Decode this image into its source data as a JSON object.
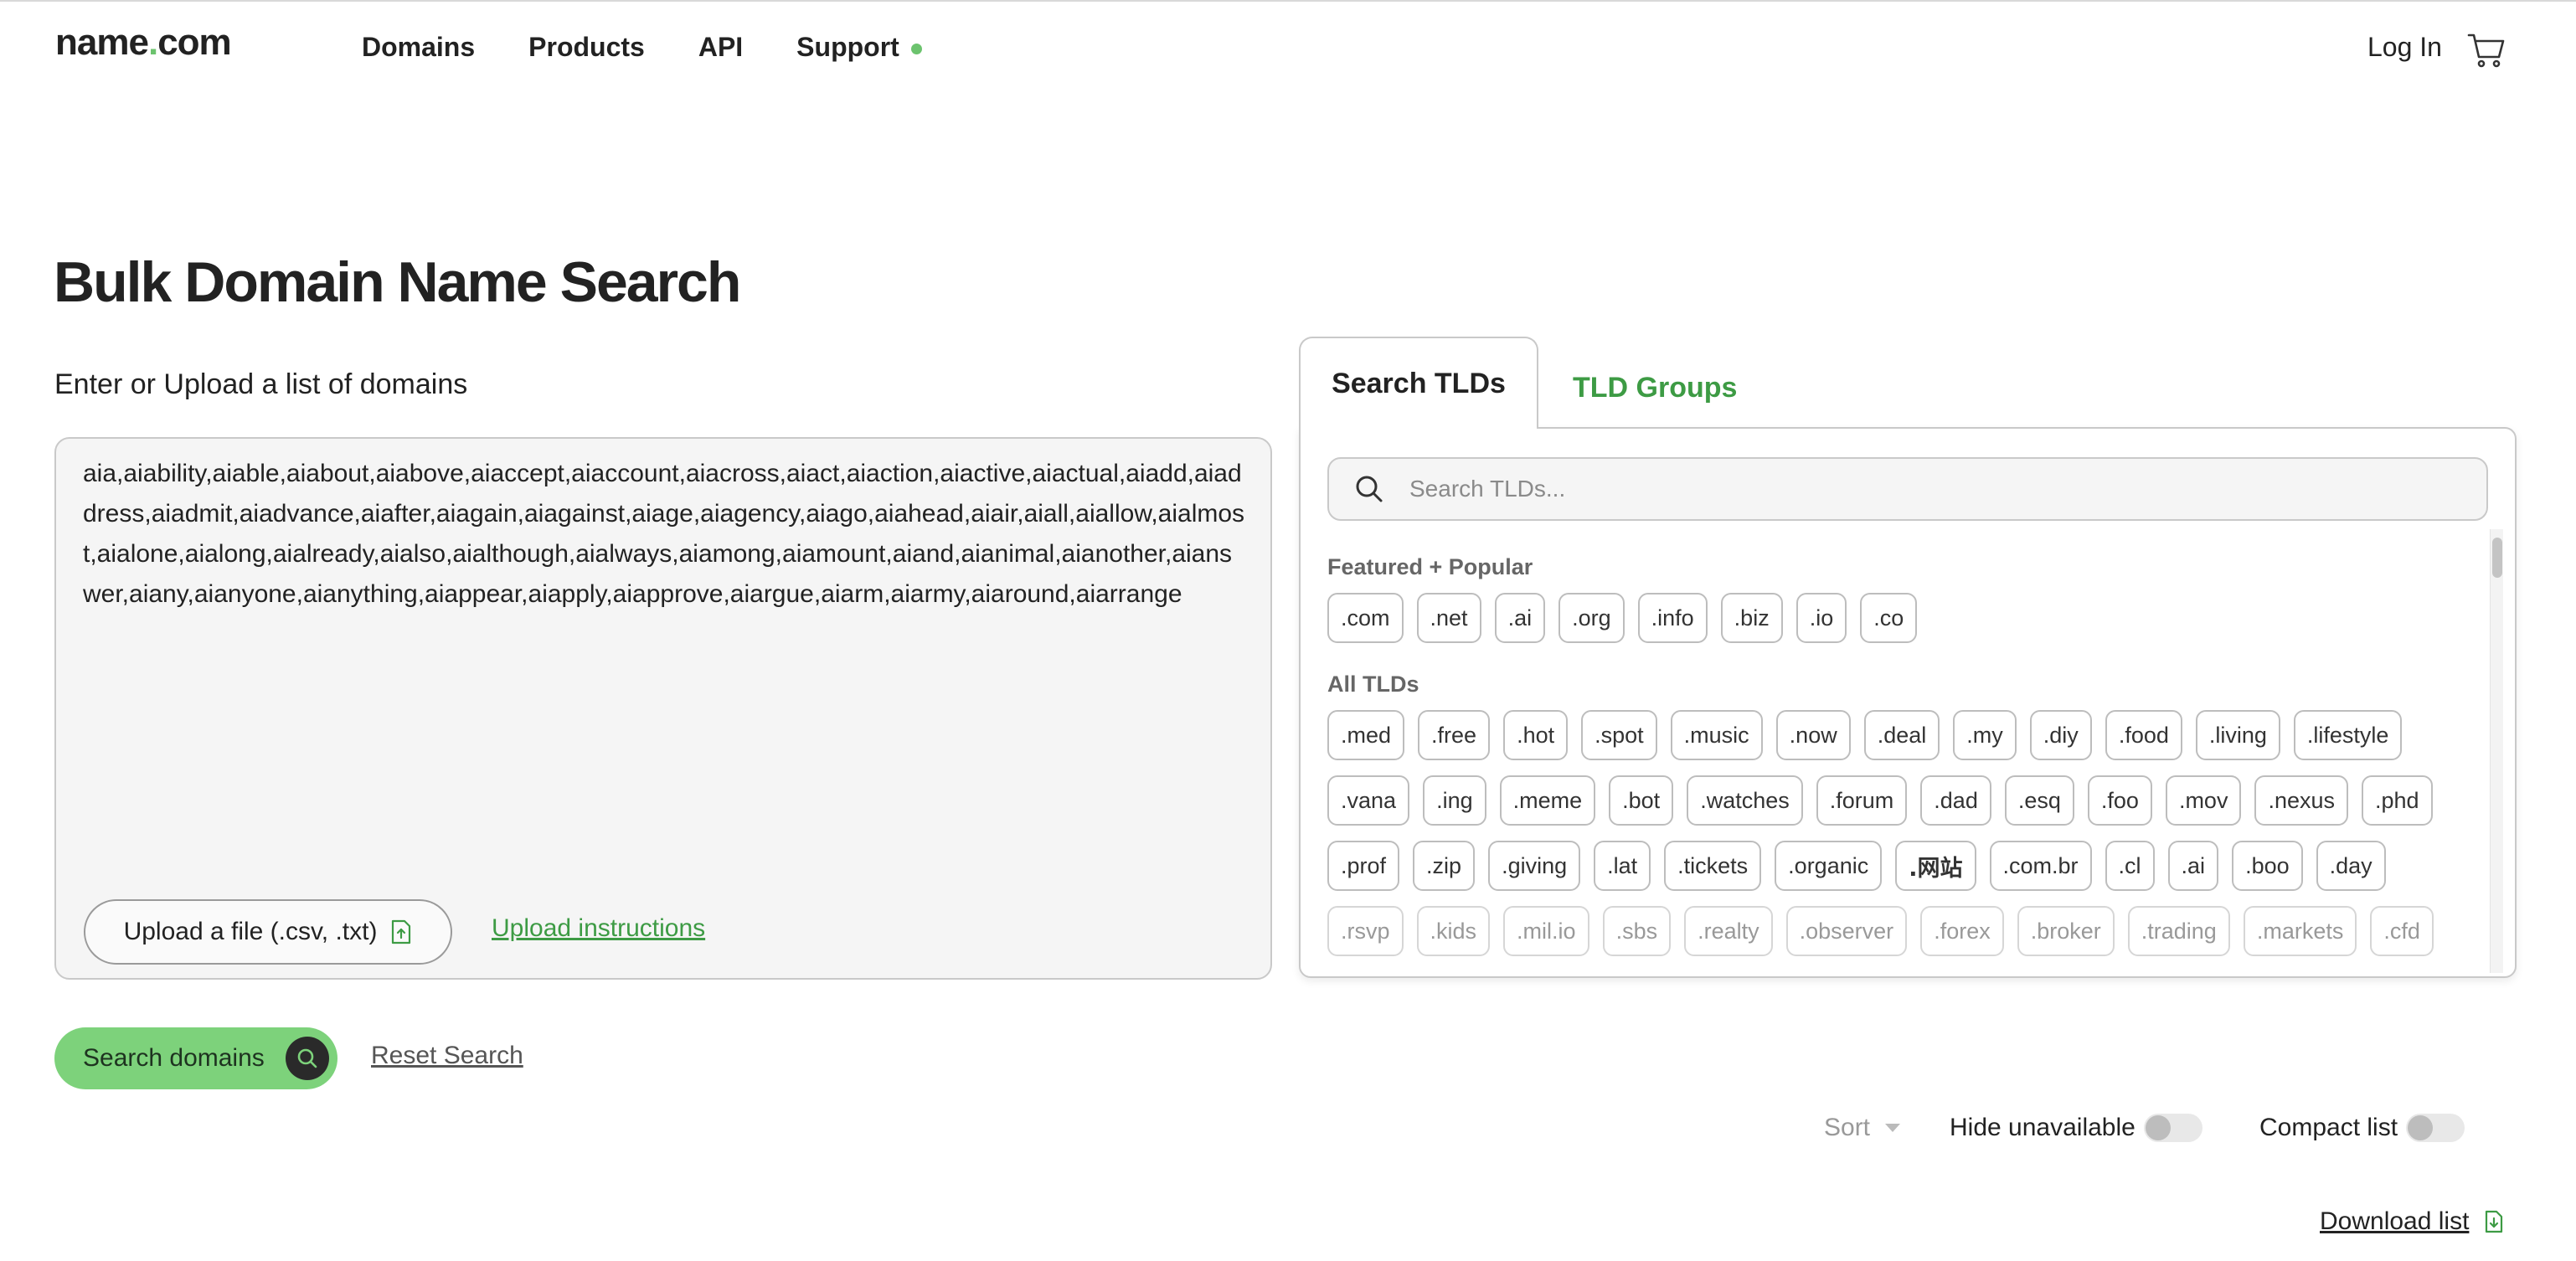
{
  "header": {
    "logo_name": "name",
    "logo_dot": ".",
    "logo_tld": "com",
    "nav": [
      {
        "label": "Domains"
      },
      {
        "label": "Products"
      },
      {
        "label": "API"
      },
      {
        "label": "Support"
      }
    ],
    "login_label": "Log In",
    "cart_icon": "cart-icon"
  },
  "page": {
    "title": "Bulk Domain Name Search",
    "input_label": "Enter or Upload a list of domains",
    "domain_list": "aia,aiability,aiable,aiabout,aiabove,aiaccept,aiaccount,aiacross,aiact,aiaction,aiactive,aiactual,aiadd,aiaddress,aiadmit,aiadvance,aiafter,aiagain,aiagainst,aiage,aiagency,aiago,aiahead,aiair,aiall,aiallow,aialmost,aialone,aialong,aialready,aialso,aialthough,aialways,aiamong,aiamount,aiand,aianimal,aianother,aianswer,aiany,aianyone,aianything,aiappear,aiapply,aiapprove,aiargue,aiarm,aiarmy,aiaround,aiarrange",
    "upload_button": "Upload a file (.csv, .txt)",
    "upload_instructions": "Upload instructions",
    "search_button": "Search domains",
    "reset_link": "Reset Search"
  },
  "tld_panel": {
    "tabs": [
      {
        "label": "Search TLDs",
        "active": true
      },
      {
        "label": "TLD Groups",
        "active": false
      }
    ],
    "search_placeholder": "Search TLDs...",
    "featured_label": "Featured + Popular",
    "featured": [
      ".com",
      ".net",
      ".ai",
      ".org",
      ".info",
      ".biz",
      ".io",
      ".co"
    ],
    "all_label": "All TLDs",
    "all": [
      ".med",
      ".free",
      ".hot",
      ".spot",
      ".music",
      ".now",
      ".deal",
      ".my",
      ".diy",
      ".food",
      ".living",
      ".lifestyle",
      ".vana",
      ".ing",
      ".meme",
      ".bot",
      ".watches",
      ".forum",
      ".dad",
      ".esq",
      ".foo",
      ".mov",
      ".nexus",
      ".phd",
      ".prof",
      ".zip",
      ".giving",
      ".lat",
      ".tickets",
      ".organic",
      ".网站",
      ".com.br",
      ".cl",
      ".ai",
      ".boo",
      ".day",
      ".rsvp",
      ".kids",
      ".mil.io",
      ".sbs",
      ".realty",
      ".observer",
      ".forex",
      ".broker",
      ".trading",
      ".markets",
      ".cfd"
    ]
  },
  "controls": {
    "sort_label": "Sort",
    "hide_unavailable_label": "Hide unavailable",
    "compact_list_label": "Compact list",
    "download_label": "Download list"
  },
  "colors": {
    "accent_green": "#6cc36e",
    "link_green": "#3d9b44",
    "button_green": "#7dd27b",
    "text_dark": "#222222"
  }
}
